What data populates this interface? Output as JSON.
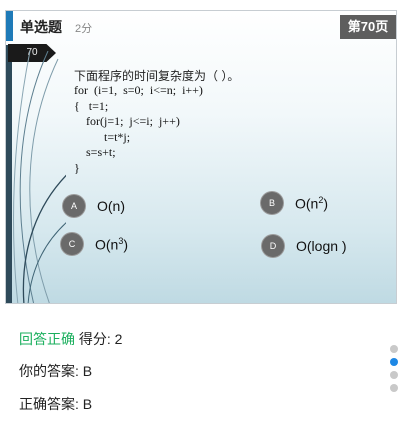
{
  "header": {
    "type_label": "单选题",
    "score_label": "2分",
    "page_label": "第70页"
  },
  "slide": {
    "number_tag": "70",
    "question": "下面程序的时间复杂度为（ ）。",
    "code": "for  (i=1,  s=0;  i<=n;  i++)\n{   t=1;\n    for(j=1;  j<=i;  j++)\n          t=t*j;\n    s=s+t;\n}",
    "options": [
      {
        "letter": "A",
        "text": "O(n)"
      },
      {
        "letter": "B",
        "text": "O(n",
        "sup": "2",
        "tail": ")"
      },
      {
        "letter": "C",
        "text": "O(n",
        "sup": "3",
        "tail": ")"
      },
      {
        "letter": "D",
        "text": "O(logn )"
      }
    ]
  },
  "result": {
    "status": "回答正确",
    "score_text": "得分: 2",
    "your_answer": "你的答案: B",
    "correct_answer": "正确答案: B"
  },
  "pager": {
    "total": 4,
    "active_index": 1
  },
  "colors": {
    "correct": "#1aaf5d",
    "pager_active": "#1e88e5",
    "accent": "#1e7ab8"
  }
}
